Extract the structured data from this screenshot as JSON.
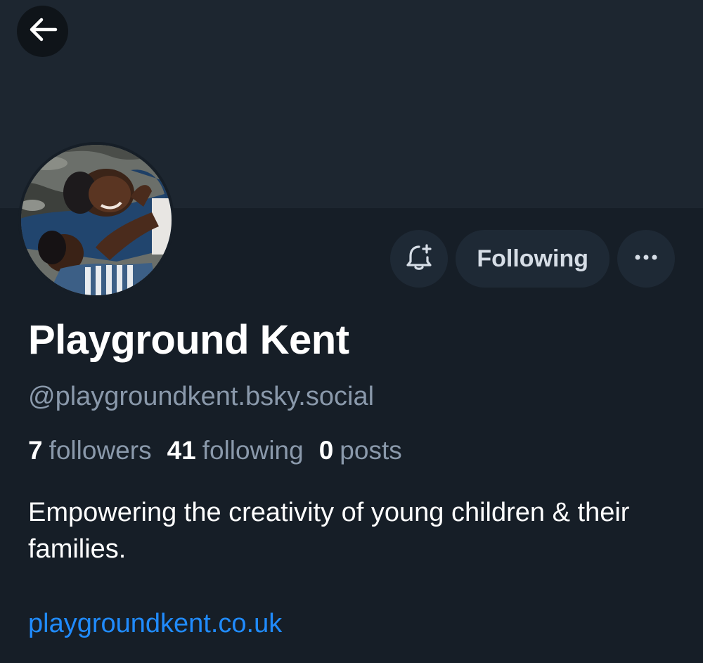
{
  "profile": {
    "display_name": "Playground Kent",
    "handle": "@playgroundkent.bsky.social",
    "stats": {
      "followers_count": "7",
      "followers_label": "followers",
      "following_count": "41",
      "following_label": "following",
      "posts_count": "0",
      "posts_label": "posts"
    },
    "bio": "Empowering the creativity of young children & their families.",
    "link": "playgroundkent.co.uk"
  },
  "actions": {
    "following_label": "Following",
    "notify_icon": "bell-plus-icon",
    "more_icon": "ellipsis-icon"
  },
  "nav": {
    "back_icon": "arrow-left-icon"
  },
  "colors": {
    "background": "#161e27",
    "banner": "#1d2630",
    "button_bg": "#1e2935",
    "muted_text": "#8a99ab",
    "link": "#208bfe"
  }
}
